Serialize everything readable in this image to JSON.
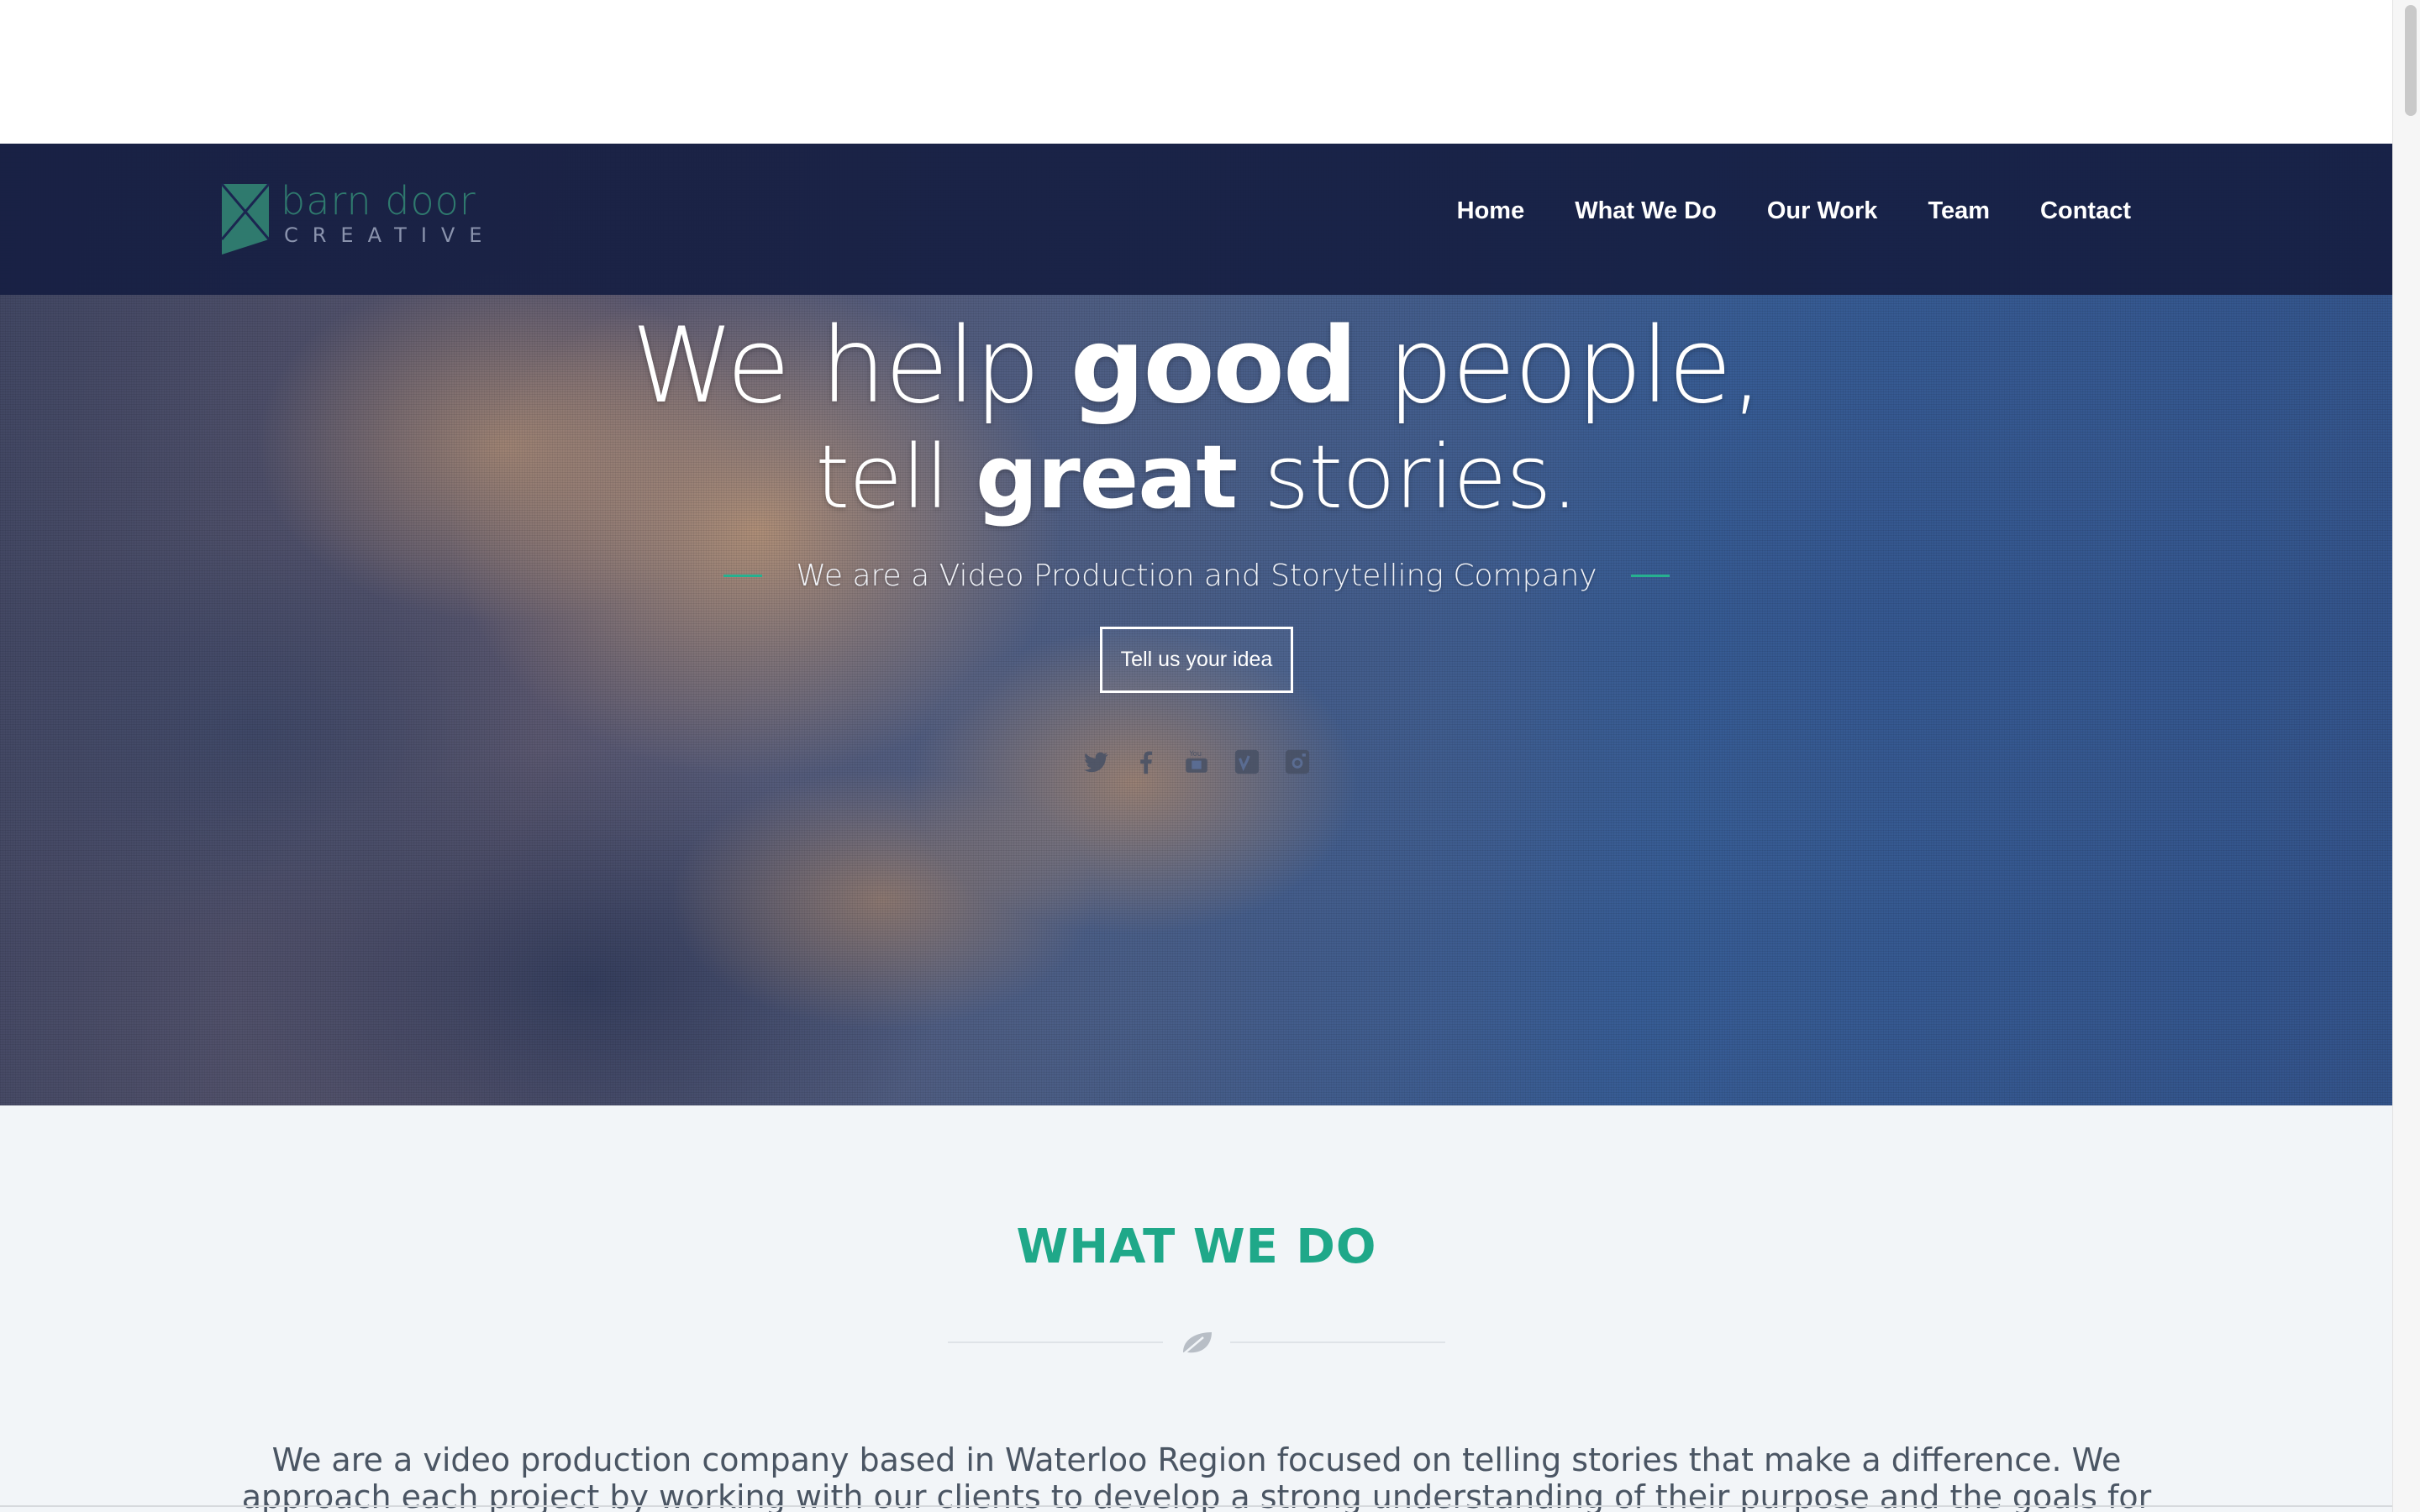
{
  "brand": {
    "name": "barn door",
    "sub": "CREATIVE",
    "accent": "#1fa889"
  },
  "nav": {
    "items": [
      {
        "label": "Home"
      },
      {
        "label": "What We Do"
      },
      {
        "label": "Our Work"
      },
      {
        "label": "Team"
      },
      {
        "label": "Contact"
      }
    ]
  },
  "hero": {
    "line1_pre": "We help ",
    "line1_bold": "good",
    "line1_post": " people,",
    "line2_pre": "tell ",
    "line2_bold": "great",
    "line2_post": " stories.",
    "tagline": "We are a Video Production and Storytelling Company",
    "cta": "Tell us your idea",
    "socials": [
      "twitter-icon",
      "facebook-icon",
      "youtube-icon",
      "vimeo-icon",
      "instagram-icon"
    ]
  },
  "what_we_do": {
    "title": "WHAT WE DO",
    "icon": "leaf-icon",
    "text": "We are a video production company based in Waterloo Region focused on telling stories that make a difference. We approach each project by working with our clients to develop a strong understanding of their purpose and the goals for their video. We use this"
  }
}
